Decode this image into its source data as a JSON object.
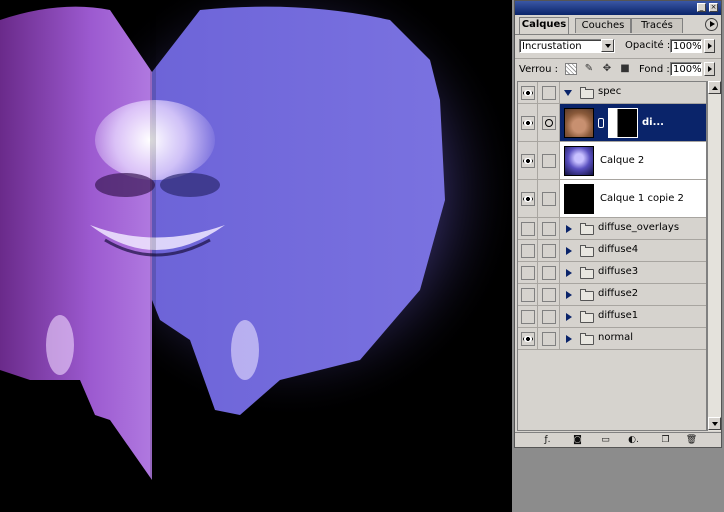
{
  "palette": {
    "tabs": [
      {
        "label": "Calques",
        "active": true
      },
      {
        "label": "Couches",
        "active": false
      },
      {
        "label": "Tracés",
        "active": false
      }
    ],
    "blend_mode": "Incrustation",
    "opacity_label": "Opacité :",
    "opacity_value": "100%",
    "lock_label": "Verrou :",
    "fill_label": "Fond :",
    "fill_value": "100%"
  },
  "layers": [
    {
      "name": "spec",
      "kind": "group-open",
      "visible": true
    },
    {
      "name": "di...",
      "kind": "layer-masked",
      "visible": true,
      "selected": true
    },
    {
      "name": "Calque 2",
      "kind": "layer",
      "visible": true
    },
    {
      "name": "Calque 1 copie 2",
      "kind": "layer",
      "visible": true
    },
    {
      "name": "diffuse_overlays",
      "kind": "group",
      "visible": false
    },
    {
      "name": "diffuse4",
      "kind": "group",
      "visible": false
    },
    {
      "name": "diffuse3",
      "kind": "group",
      "visible": false
    },
    {
      "name": "diffuse2",
      "kind": "group",
      "visible": false
    },
    {
      "name": "diffuse1",
      "kind": "group",
      "visible": false
    },
    {
      "name": "normal",
      "kind": "group",
      "visible": true
    }
  ],
  "icons": {
    "bottom": [
      "layer-style-icon",
      "add-mask-icon",
      "new-group-icon",
      "adjustment-layer-icon",
      "new-layer-icon",
      "trash-icon"
    ],
    "lock": [
      "lock-transparency-icon",
      "lock-paint-icon",
      "lock-move-icon",
      "lock-all-icon"
    ]
  }
}
